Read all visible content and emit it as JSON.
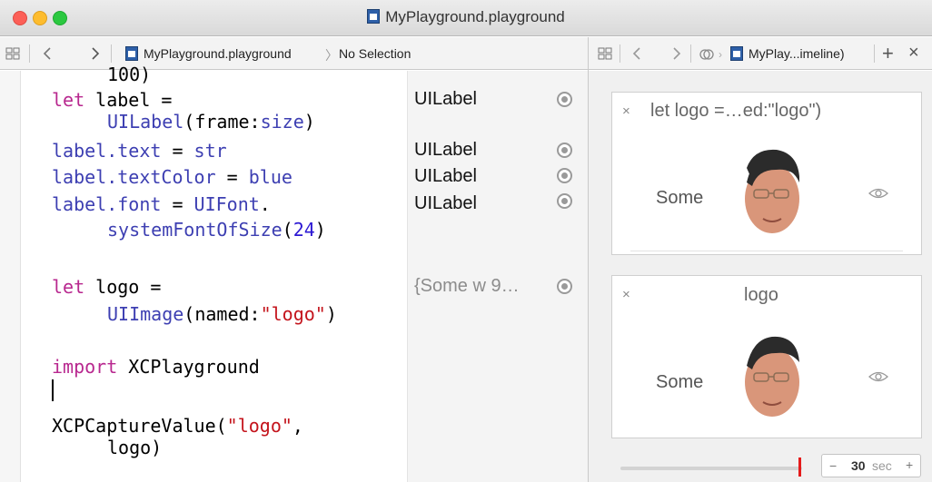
{
  "window": {
    "title": "MyPlayground.playground"
  },
  "editor_jumpbar": {
    "file": "MyPlayground.playground",
    "separator": "〉",
    "selection": "No Selection"
  },
  "timeline_jumpbar": {
    "file": "MyPlay...imeline)",
    "add": "+",
    "close": "×"
  },
  "code": {
    "line0": "100)",
    "line1_kw": "let",
    "line1_rest": " label =",
    "line2_fn": "UILabel",
    "line2_a": "(frame:",
    "line2_b": "size",
    "line2_c": ")",
    "line3_a": "label.",
    "line3_b": "text",
    "line3_c": " = ",
    "line3_d": "str",
    "line4_a": "label.",
    "line4_b": "textColor",
    "line4_c": " = ",
    "line4_d": "blue",
    "line5_a": "label.",
    "line5_b": "font",
    "line5_c": " = ",
    "line5_d": "UIFont",
    "line5_e": ".",
    "line6_fn": "systemFontOfSize",
    "line6_a": "(",
    "line6_num": "24",
    "line6_b": ")",
    "line7_kw": "let",
    "line7_rest": " logo =",
    "line8_fn": "UIImage",
    "line8_a": "(named:",
    "line8_str": "\"logo\"",
    "line8_b": ")",
    "line9_kw": "import",
    "line9_rest": " XCPlayground",
    "line10_a": "XCPCaptureValue(",
    "line10_str": "\"logo\"",
    "line10_b": ",",
    "line11": "logo)"
  },
  "results": {
    "r1": "UILabel",
    "r2": "UILabel",
    "r3": "UILabel",
    "r4": "UILabel",
    "r5": "{Some w 9…"
  },
  "cards": [
    {
      "close": "×",
      "title": "let logo =…ed:\"logo\")",
      "content": "Some"
    },
    {
      "close": "×",
      "title": "logo",
      "content": "Some"
    }
  ],
  "stepper": {
    "minus": "−",
    "value": "30",
    "unit": "sec",
    "plus": "+"
  },
  "colors": {
    "keyword": "#b8288f",
    "function": "#3d3fb2",
    "string": "#c4141c",
    "number": "#2c18d3",
    "timeline_marker": "#e51b1b"
  }
}
